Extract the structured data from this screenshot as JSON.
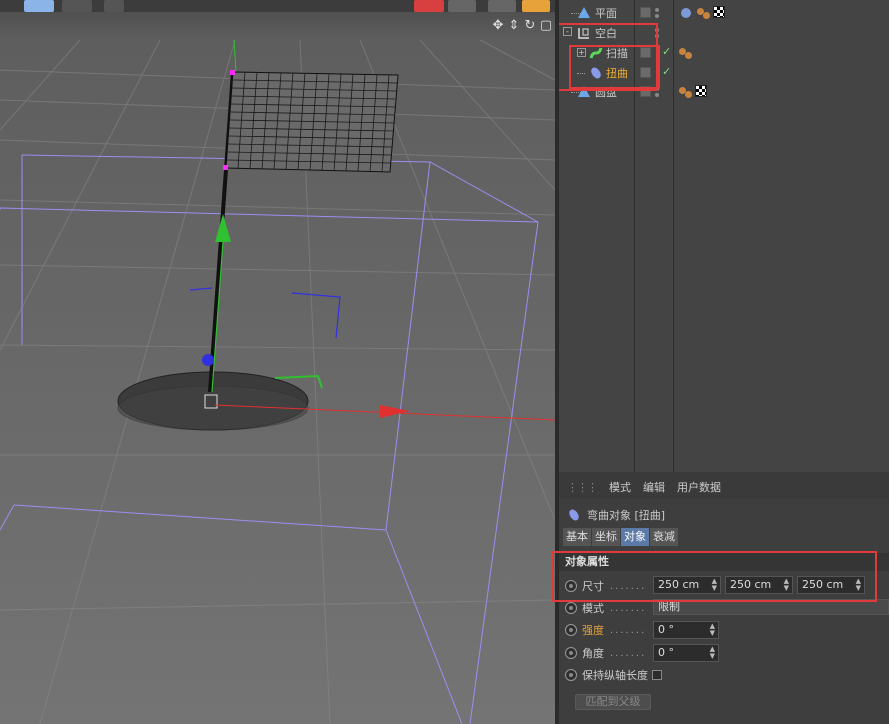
{
  "viewport": {
    "nav_icons": [
      "✥",
      "⇕",
      "↻",
      "▢"
    ],
    "colors": {
      "x_axis": "#e03030",
      "y_axis": "#30c030",
      "z_axis": "#3030e0",
      "bbox": "#9a8ff0",
      "handle": "#ff2bff"
    }
  },
  "objects": {
    "items": [
      {
        "name": "平面",
        "icon": "plane-icon",
        "indent": 0,
        "selected": false,
        "check": false,
        "tags": 2,
        "checker": true
      },
      {
        "name": "空白",
        "icon": "null-icon",
        "indent": 0,
        "selected": false,
        "check": false,
        "tags": 0,
        "checker": false
      },
      {
        "name": "扫描",
        "icon": "sweep-icon",
        "indent": 1,
        "selected": false,
        "check": true,
        "tags": 2,
        "checker": false
      },
      {
        "name": "扭曲",
        "icon": "bend-icon",
        "indent": 1,
        "selected": true,
        "check": true,
        "tags": 0,
        "checker": false
      },
      {
        "name": "圆盘",
        "icon": "disc-icon",
        "indent": 0,
        "selected": false,
        "check": false,
        "tags": 2,
        "checker": true
      }
    ]
  },
  "attributes": {
    "menu": [
      "模式",
      "编辑",
      "用户数据"
    ],
    "title": "弯曲对象 [扭曲]",
    "tabs": [
      {
        "label": "基本",
        "active": false
      },
      {
        "label": "坐标",
        "active": false
      },
      {
        "label": "对象",
        "active": true
      },
      {
        "label": "衰减",
        "active": false
      }
    ],
    "section": "对象属性",
    "size": {
      "label": "尺寸",
      "values": [
        "250 cm",
        "250 cm",
        "250 cm"
      ]
    },
    "mode": {
      "label": "模式",
      "value": "限制"
    },
    "strength": {
      "label": "强度",
      "value": "0 °"
    },
    "angle": {
      "label": "角度",
      "value": "0 °"
    },
    "keep_length": {
      "label": "保持纵轴长度"
    },
    "match_button": "匹配到父级"
  }
}
